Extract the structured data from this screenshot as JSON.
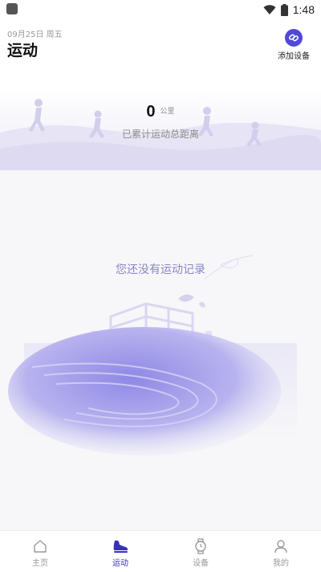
{
  "status_bar": {
    "time": "1:48",
    "icons": [
      "app-notification-icon",
      "wifi-icon",
      "battery-icon"
    ]
  },
  "header": {
    "date": "09月25日 周五",
    "title": "运动",
    "add_device_label": "添加设备",
    "add_device_icon": "link-icon"
  },
  "summary": {
    "distance_value": "0",
    "distance_unit": "公里",
    "caption": "已累计运动总距离"
  },
  "empty_state": {
    "message": "您还没有运动记录"
  },
  "bottom_nav": {
    "items": [
      {
        "label": "主页",
        "icon": "home-icon",
        "active": false
      },
      {
        "label": "运动",
        "icon": "sneaker-icon",
        "active": true
      },
      {
        "label": "设备",
        "icon": "watch-icon",
        "active": false
      },
      {
        "label": "我的",
        "icon": "profile-icon",
        "active": false
      }
    ]
  },
  "colors": {
    "accent": "#5148d6",
    "active_nav": "#3a2fc4",
    "empty_text": "#8a86c8",
    "background": "#f7f7f9"
  }
}
